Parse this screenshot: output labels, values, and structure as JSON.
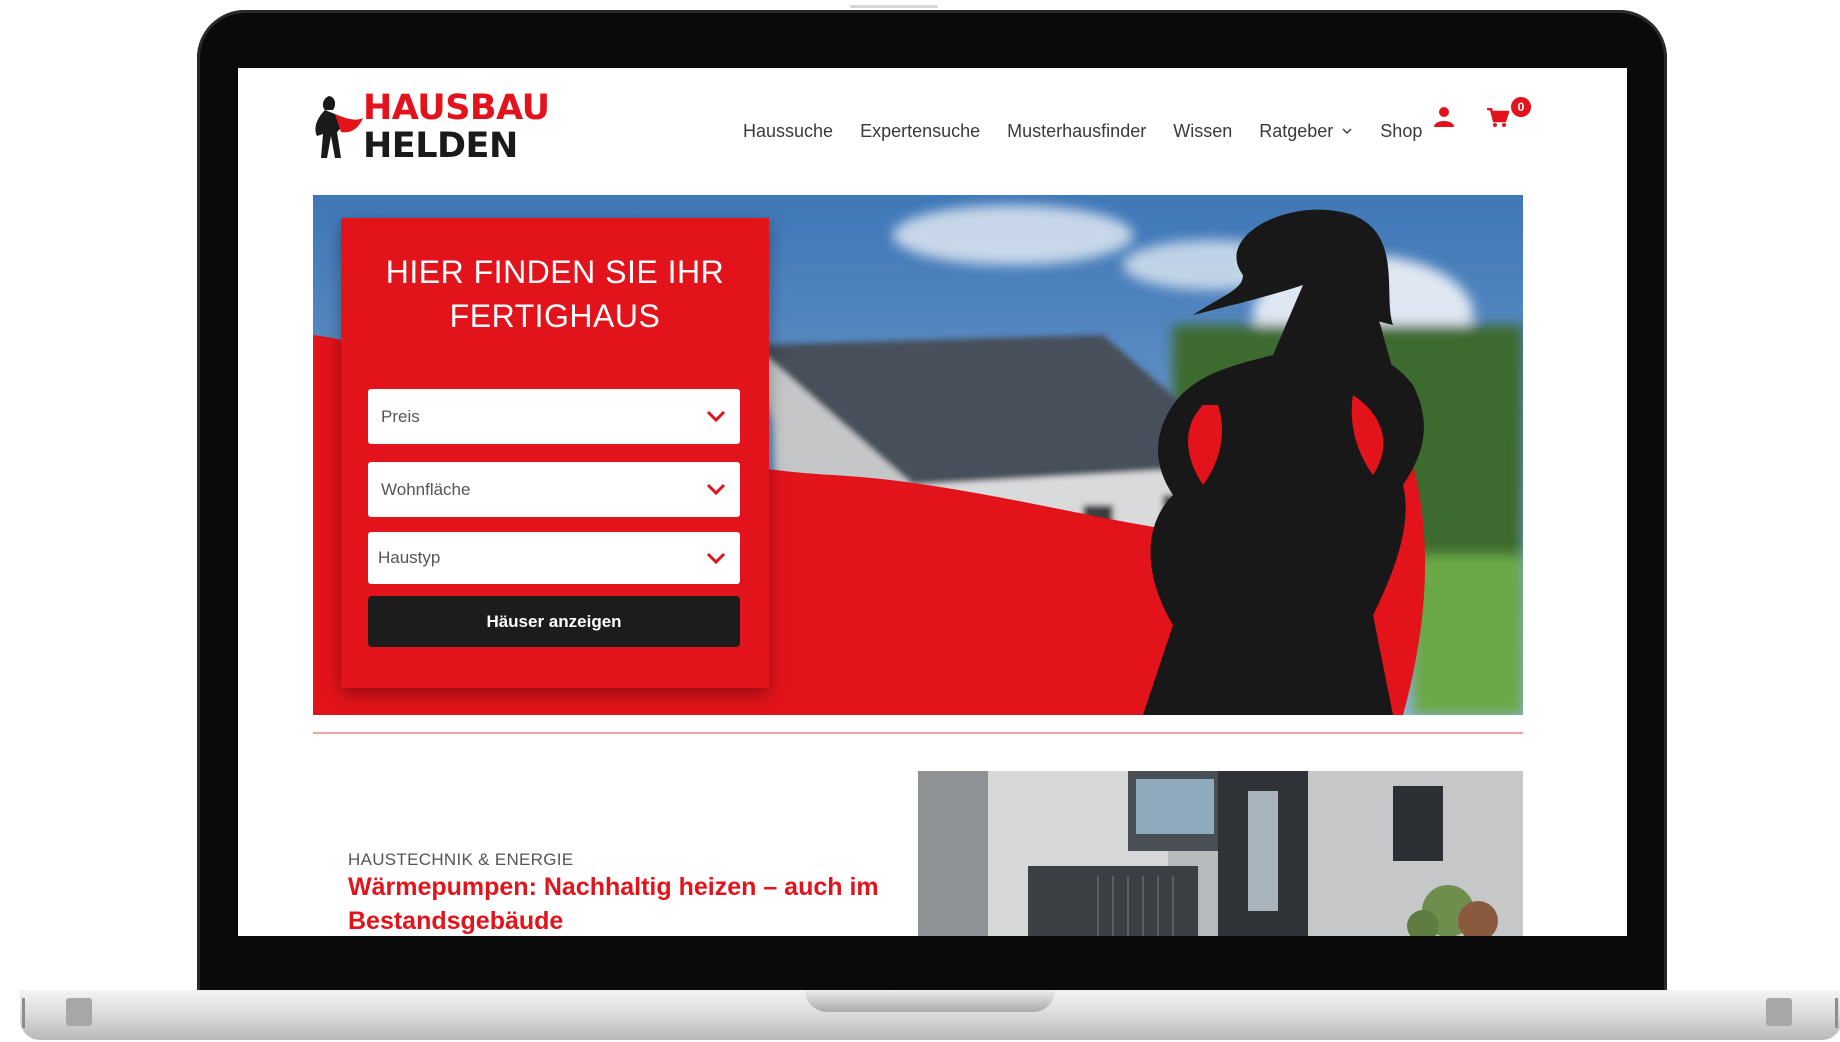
{
  "logo": {
    "line1": "HAUSBAU",
    "line2": "HELDEN",
    "figure_icon": "superhero-woman-silhouette"
  },
  "nav": {
    "items": [
      {
        "label": "Haussuche"
      },
      {
        "label": "Expertensuche"
      },
      {
        "label": "Musterhausfinder"
      },
      {
        "label": "Wissen"
      },
      {
        "label": "Ratgeber",
        "has_dropdown": true
      },
      {
        "label": "Shop"
      }
    ],
    "user_icon": "user-icon",
    "cart_icon": "shopping-cart-icon",
    "cart_count": "0"
  },
  "hero": {
    "title": "HIER FINDEN SIE IHR FERTIGHAUS",
    "filters": [
      {
        "label": "Preis"
      },
      {
        "label": "Wohnfläche"
      },
      {
        "label": "Haustyp"
      }
    ],
    "button_label": "Häuser anzeigen"
  },
  "article": {
    "category": "HAUSTECHNIK & ENERGIE",
    "title": "Wärmepumpen: Nachhaltig heizen – auch im Bestandsgebäude"
  },
  "colors": {
    "brand_red": "#e3131b",
    "dark": "#1c1c1c",
    "text_gray": "#3a3a3a"
  }
}
